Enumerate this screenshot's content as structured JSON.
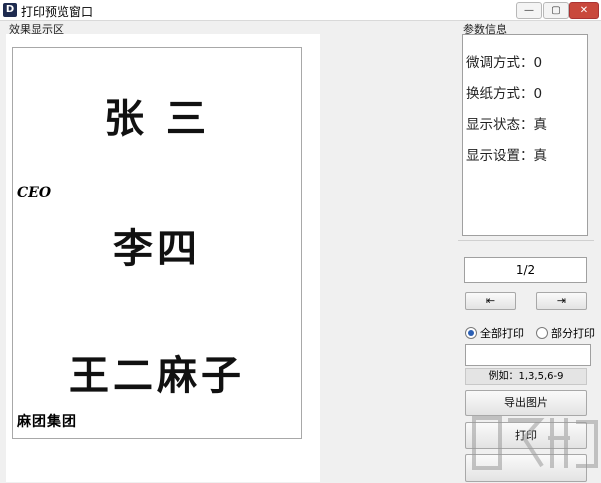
{
  "window": {
    "title": "打印预览窗口",
    "app_icon_glyph": "D"
  },
  "window_controls": {
    "minimize": "—",
    "restore": "▢",
    "close": "✕"
  },
  "preview": {
    "label": "效果显示区",
    "cards": [
      {
        "name": "张 三",
        "title_tag": "",
        "company": ""
      },
      {
        "name": "李四",
        "title_tag": "CEO",
        "company": ""
      },
      {
        "name": "王二麻子",
        "title_tag": "",
        "company": "麻团集团"
      }
    ]
  },
  "info": {
    "label": "参数信息",
    "rows": [
      {
        "key": "微调方式：",
        "value": "0"
      },
      {
        "key": "换纸方式：",
        "value": "0"
      },
      {
        "key": "显示状态：",
        "value": "真"
      },
      {
        "key": "显示设置：",
        "value": "真"
      }
    ]
  },
  "controls": {
    "page_indicator": "1/2",
    "prev_glyph": "⇤",
    "next_glyph": "⇥",
    "print_all_label": "全部打印",
    "print_part_label": "部分打印",
    "print_all_selected": true,
    "range_value": "",
    "example_text": "例如：1,3,5,6-9",
    "export_label": "导出图片",
    "print_label": "打印"
  }
}
